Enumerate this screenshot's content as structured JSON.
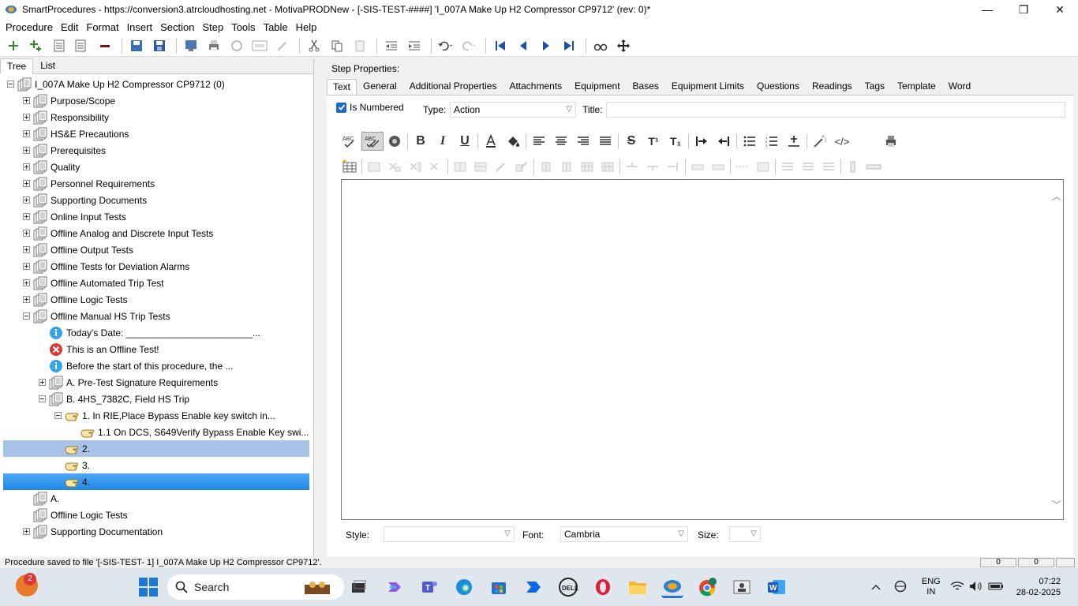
{
  "window": {
    "title": "SmartProcedures - https://conversion3.atrcloudhosting.net - MotivaPRODNew - [-SIS-TEST-####] 'I_007A Make Up H2 Compressor CP9712' (rev: 0)*",
    "minimize": "—",
    "maximize": "❐",
    "close": "✕"
  },
  "menu": [
    "Procedure",
    "Edit",
    "Format",
    "Insert",
    "Section",
    "Step",
    "Tools",
    "Table",
    "Help"
  ],
  "left_tabs": [
    "Tree",
    "List"
  ],
  "tree": [
    {
      "label": "I_007A Make Up H2 Compressor CP9712 (0)",
      "level": 0,
      "exp": "minus",
      "icon": "doc"
    },
    {
      "label": "Purpose/Scope",
      "level": 1,
      "exp": "plus",
      "icon": "doc"
    },
    {
      "label": "Responsibility",
      "level": 1,
      "exp": "plus",
      "icon": "doc"
    },
    {
      "label": "HS&E Precautions",
      "level": 1,
      "exp": "plus",
      "icon": "doc"
    },
    {
      "label": "Prerequisites",
      "level": 1,
      "exp": "plus",
      "icon": "doc"
    },
    {
      "label": "Quality",
      "level": 1,
      "exp": "plus",
      "icon": "doc"
    },
    {
      "label": "Personnel Requirements",
      "level": 1,
      "exp": "plus",
      "icon": "doc"
    },
    {
      "label": "Supporting Documents",
      "level": 1,
      "exp": "plus",
      "icon": "doc"
    },
    {
      "label": "Online Input Tests",
      "level": 1,
      "exp": "plus",
      "icon": "doc"
    },
    {
      "label": "Offline Analog and Discrete Input Tests",
      "level": 1,
      "exp": "plus",
      "icon": "doc"
    },
    {
      "label": "Offline Output Tests",
      "level": 1,
      "exp": "plus",
      "icon": "doc"
    },
    {
      "label": "Offline Tests for Deviation Alarms",
      "level": 1,
      "exp": "plus",
      "icon": "doc"
    },
    {
      "label": "Offline Automated Trip Test",
      "level": 1,
      "exp": "plus",
      "icon": "doc"
    },
    {
      "label": "Offline Logic Tests",
      "level": 1,
      "exp": "plus",
      "icon": "doc"
    },
    {
      "label": "Offline Manual HS Trip Tests",
      "level": 1,
      "exp": "minus",
      "icon": "doc"
    },
    {
      "label": "Today's Date: ________________________...",
      "level": 2,
      "exp": "",
      "icon": "info"
    },
    {
      "label": "This is an Offline Test!",
      "level": 2,
      "exp": "",
      "icon": "error"
    },
    {
      "label": "Before the start of this procedure, the ...",
      "level": 2,
      "exp": "",
      "icon": "info"
    },
    {
      "label": "A. Pre-Test Signature Requirements",
      "level": 2,
      "exp": "plus",
      "icon": "doc"
    },
    {
      "label": "B. 4HS_7382C, Field HS Trip",
      "level": 2,
      "exp": "minus",
      "icon": "doc"
    },
    {
      "label": "1. In RIE,Place Bypass Enable key switch in...",
      "level": 3,
      "exp": "minus",
      "icon": "hand"
    },
    {
      "label": "1.1 On DCS, S649Verify Bypass Enable Key swi...",
      "level": 4,
      "exp": "",
      "icon": "hand"
    },
    {
      "label": "2.",
      "level": 3,
      "exp": "",
      "icon": "hand",
      "sel": "light"
    },
    {
      "label": "3.",
      "level": 3,
      "exp": "",
      "icon": "hand"
    },
    {
      "label": "4.",
      "level": 3,
      "exp": "",
      "icon": "hand",
      "sel": "strong"
    },
    {
      "label": "A.",
      "level": 1,
      "exp": "",
      "icon": "doc"
    },
    {
      "label": "Offline Logic Tests",
      "level": 1,
      "exp": "",
      "icon": "doc"
    },
    {
      "label": "Supporting Documentation",
      "level": 1,
      "exp": "plus",
      "icon": "doc"
    }
  ],
  "step_properties": {
    "heading": "Step Properties:",
    "tabs": [
      "Text",
      "General",
      "Additional Properties",
      "Attachments",
      "Equipment",
      "Bases",
      "Equipment Limits",
      "Questions",
      "Readings",
      "Tags",
      "Template",
      "Word"
    ],
    "is_numbered_label": "Is Numbered",
    "type_label": "Type:",
    "type_value": "Action",
    "title_label": "Title:",
    "title_value": "",
    "style_label": "Style:",
    "style_value": "",
    "font_label": "Font:",
    "font_value": "Cambria",
    "size_label": "Size:",
    "size_value": ""
  },
  "format_buttons": {
    "bold": "B",
    "italic": "I",
    "underline": "U",
    "strike": "S",
    "superscript": "T¹",
    "subscript": "T₁",
    "html": "</>"
  },
  "status": {
    "message": "Procedure saved to file '[-SIS-TEST-     1] I_007A Make Up H2 Compressor CP9712'.",
    "panel1": "0",
    "panel2": "0"
  },
  "taskbar": {
    "weather_badge": "2",
    "search_label": "Search",
    "lang_line1": "ENG",
    "lang_line2": "IN",
    "time": "07:22",
    "date": "28-02-2025"
  }
}
